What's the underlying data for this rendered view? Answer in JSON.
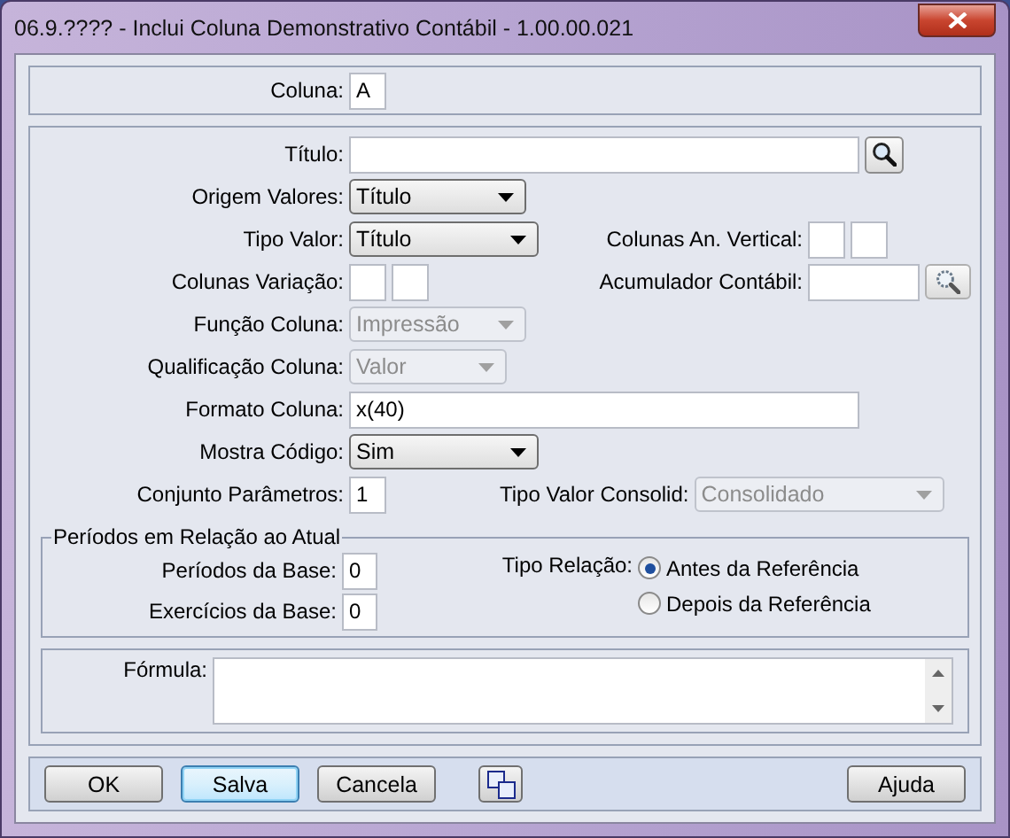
{
  "window": {
    "title": "06.9.???? - Inclui Coluna Demonstrativo Contábil - 1.00.00.021"
  },
  "coluna": {
    "label": "Coluna:",
    "value": "A"
  },
  "titulo": {
    "label": "Título:"
  },
  "origem_valores": {
    "label": "Origem Valores:",
    "value": "Título",
    "disabled": false
  },
  "tipo_valor": {
    "label": "Tipo Valor:",
    "value": "Título",
    "disabled": false
  },
  "colunas_an_vertical": {
    "label": "Colunas An. Vertical:"
  },
  "colunas_variacao": {
    "label": "Colunas Variação:"
  },
  "acumulador_contabil": {
    "label": "Acumulador Contábil:"
  },
  "funcao_coluna": {
    "label": "Função Coluna:",
    "value": "Impressão",
    "disabled": true
  },
  "qualificacao_coluna": {
    "label": "Qualificação Coluna:",
    "value": "Valor",
    "disabled": true
  },
  "formato_coluna": {
    "label": "Formato Coluna:",
    "value": "x(40)"
  },
  "mostra_codigo": {
    "label": "Mostra Código:",
    "value": "Sim",
    "disabled": false
  },
  "conjunto_parametros": {
    "label": "Conjunto Parâmetros:",
    "value": "1"
  },
  "tipo_valor_consolid": {
    "label": "Tipo Valor Consolid:",
    "value": "Consolidado",
    "disabled": true
  },
  "periodos": {
    "legend": "Períodos em Relação ao Atual",
    "periodos_base": {
      "label": "Períodos da Base:",
      "value": "0"
    },
    "exercicios_base": {
      "label": "Exercícios da Base:",
      "value": "0"
    },
    "tipo_relacao": {
      "label": "Tipo Relação:",
      "options": [
        {
          "label": "Antes da Referência",
          "selected": true
        },
        {
          "label": "Depois da Referência",
          "selected": false
        }
      ]
    }
  },
  "formula": {
    "label": "Fórmula:"
  },
  "buttons": [
    {
      "kind": "text",
      "label": "OK",
      "focused": false
    },
    {
      "kind": "text",
      "label": "Salva",
      "focused": true
    },
    {
      "kind": "text",
      "label": "Cancela",
      "focused": false
    },
    {
      "kind": "icon",
      "focused": false
    }
  ],
  "help_button": {
    "label": "Ajuda",
    "focused": false
  }
}
